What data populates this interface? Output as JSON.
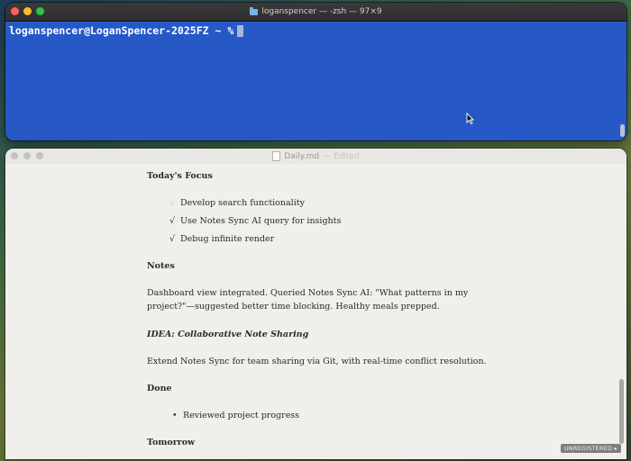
{
  "terminal": {
    "title": "loganspencer — -zsh — 97×9",
    "prompt": "loganspencer@LoganSpencer-2025FZ ~ %"
  },
  "editor": {
    "title": "Daily.md",
    "status": "— Edited",
    "doc": {
      "focus_heading": "Today's Focus",
      "focus_items": [
        {
          "check": "√",
          "text": "Develop search functionality"
        },
        {
          "check": "√",
          "text": "Use Notes Sync AI query for insights"
        },
        {
          "check": "√",
          "text": "Debug infinite render"
        }
      ],
      "notes_heading": "Notes",
      "notes_line1": "Dashboard view integrated. Queried Notes Sync AI: \"What patterns in my",
      "notes_line2": "project?\"—suggested better time blocking. Healthy meals prepped.",
      "idea_heading": "IDEA: Collaborative Note Sharing",
      "idea_text": "Extend Notes Sync for team sharing via Git, with real-time conflict resolution.",
      "done_heading": "Done",
      "done_items": [
        "Reviewed project progress"
      ],
      "tomorrow_heading": "Tomorrow"
    },
    "badge": "UNREGISTERED ▸"
  },
  "colors": {
    "terminal_bg": "#2659c6",
    "editor_bg": "#f1efeb"
  }
}
